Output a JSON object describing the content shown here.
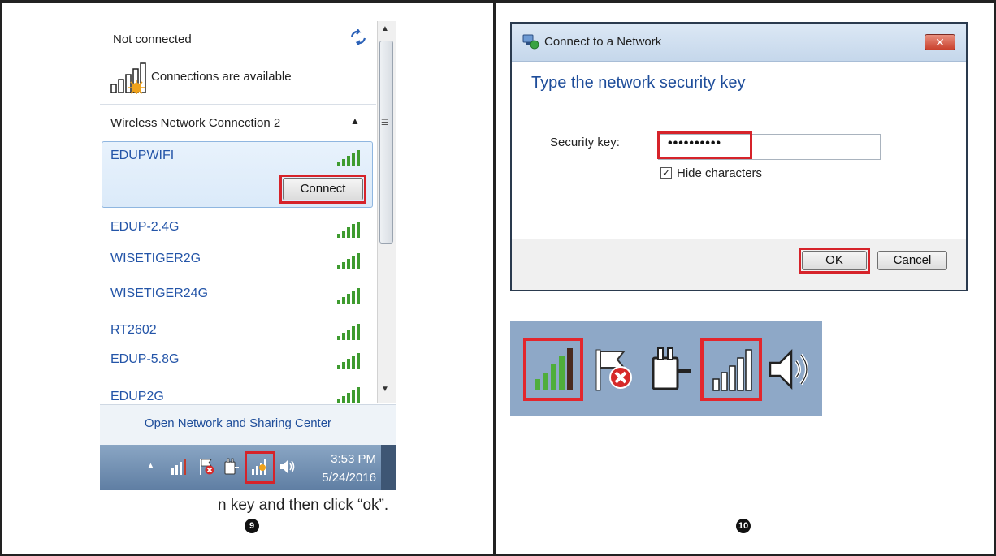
{
  "flyout": {
    "status": "Not connected",
    "connections_available": "Connections are available",
    "adapter_name": "Wireless Network Connection 2",
    "selected_network": "EDUPWIFI",
    "connect_label": "Connect",
    "networks": [
      "EDUP-2.4G",
      "WISETIGER2G",
      "WISETIGER24G",
      "RT2602",
      "EDUP-5.8G",
      "EDUP2G"
    ],
    "open_center_label": "Open Network and Sharing Center"
  },
  "taskbar": {
    "time": "3:53 PM",
    "date": "5/24/2016"
  },
  "caption": "n key and then click “ok”.",
  "steps": {
    "left": "9",
    "right": "10"
  },
  "dialog": {
    "title": "Connect to a Network",
    "heading": "Type the network security key",
    "security_key_label": "Security key:",
    "security_key_value": "••••••••••",
    "hide_characters_label": "Hide characters",
    "hide_characters_checked": "✓",
    "ok_label": "OK",
    "cancel_label": "Cancel",
    "close_glyph": "✕"
  },
  "colors": {
    "highlight": "#d6232a",
    "link_blue": "#1e4d9a",
    "signal_green": "#3e9b2f",
    "tray_blue": "#8ea8c7"
  },
  "icons": {
    "refresh": "refresh-icon",
    "signal": "signal-bars-icon",
    "flag": "action-center-flag-icon",
    "power": "power-plug-icon",
    "volume": "speaker-icon"
  }
}
